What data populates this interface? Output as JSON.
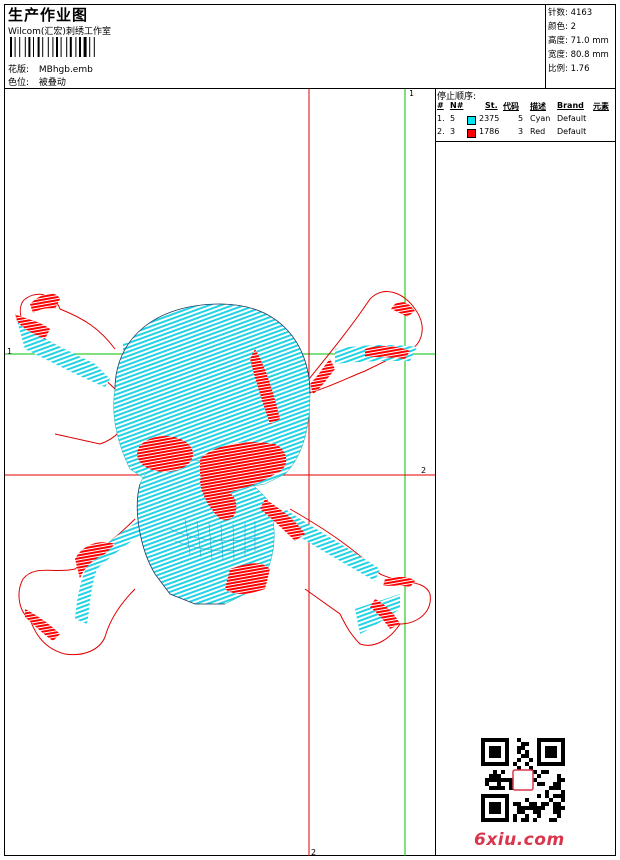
{
  "header": {
    "title": "生产作业图",
    "subtitle": "Wilcom(汇宏)刺绣工作室",
    "design_label": "花版:",
    "design_value": "MBhgb.emb",
    "color_label": "色位:",
    "color_value": "被叠动"
  },
  "stats": {
    "stitches": "针数: 4163",
    "colors": "颜色: 2",
    "height": "高度: 71.0 mm",
    "width": "宽度: 80.8 mm",
    "scale": "比例: 1.76"
  },
  "stop_sequence": {
    "title": "停止顺序:",
    "headers": [
      "#",
      "N#",
      "St.",
      "代码",
      "描述",
      "Brand",
      "元素"
    ],
    "rows": [
      {
        "idx": "1.",
        "n": "5",
        "color": "#00e5ee",
        "st": "2375",
        "code": "5",
        "desc": "Cyan",
        "brand": "Default"
      },
      {
        "idx": "2.",
        "n": "3",
        "color": "#ff0000",
        "st": "1786",
        "code": "3",
        "desc": "Red",
        "brand": "Default"
      }
    ]
  },
  "guides": {
    "green_v_label": "1",
    "green_h_label": "1",
    "red_h_label": "2",
    "red_v_label": "2"
  },
  "watermark": "6xiu.com",
  "colors": {
    "cyan": "#22d3e6",
    "red": "#ff0000",
    "guide_green": "#00c000",
    "guide_red": "#e00000"
  }
}
